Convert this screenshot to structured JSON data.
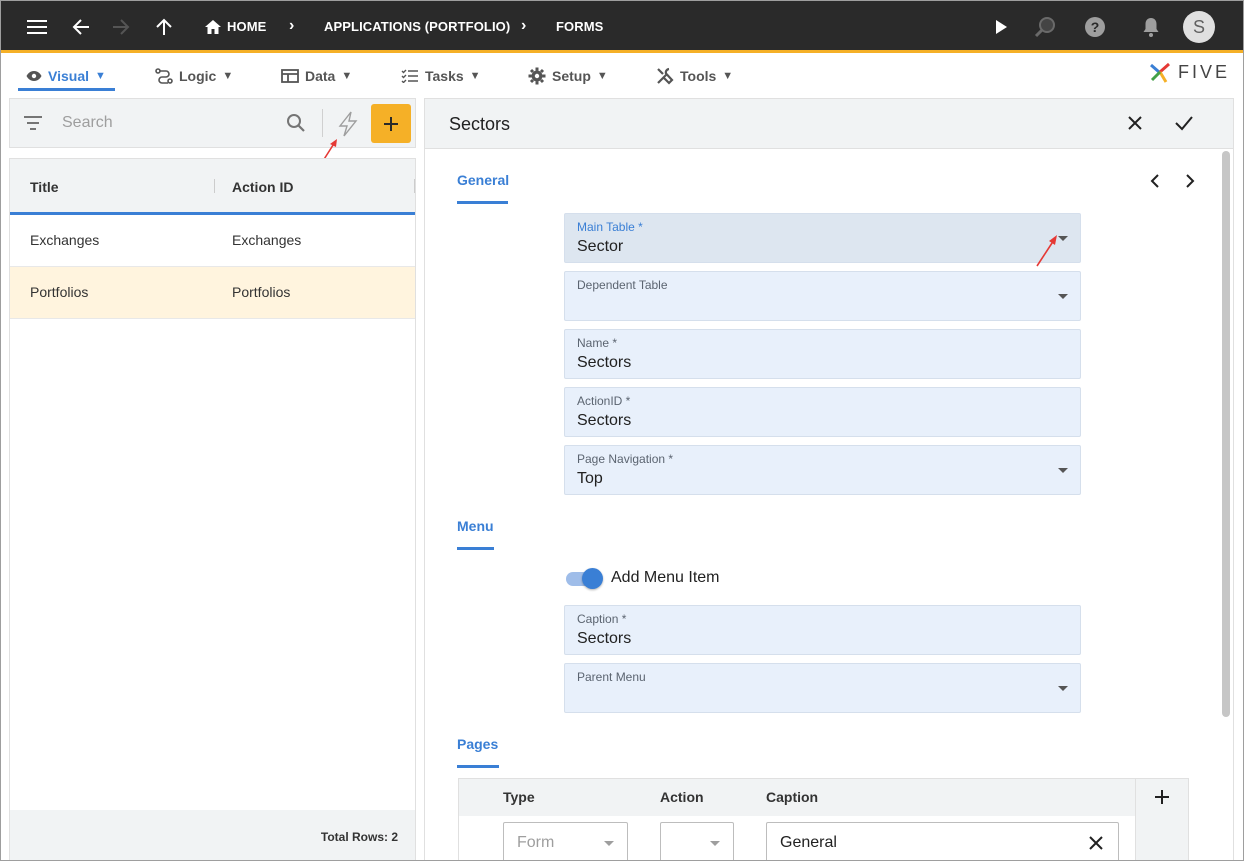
{
  "appbar": {
    "breadcrumbs": [
      "HOME",
      "APPLICATIONS (PORTFOLIO)",
      "FORMS"
    ],
    "avatar_initial": "S",
    "accent": "#f5b027"
  },
  "menubar": {
    "items": [
      {
        "label": "Visual",
        "icon": "eye-icon",
        "active": true
      },
      {
        "label": "Logic",
        "icon": "flow-icon"
      },
      {
        "label": "Data",
        "icon": "table-icon"
      },
      {
        "label": "Tasks",
        "icon": "checklist-icon"
      },
      {
        "label": "Setup",
        "icon": "gear-icon"
      },
      {
        "label": "Tools",
        "icon": "tools-icon"
      }
    ],
    "caret": "▼",
    "logo_text": "FIVE"
  },
  "list": {
    "search_placeholder": "Search",
    "columns": [
      "Title",
      "Action ID"
    ],
    "rows": [
      {
        "title": "Exchanges",
        "action_id": "Exchanges",
        "selected": false
      },
      {
        "title": "Portfolios",
        "action_id": "Portfolios",
        "selected": true
      }
    ],
    "total_rows": "Total Rows: 2"
  },
  "form": {
    "title": "Sectors",
    "sections": {
      "general": "General",
      "menu": "Menu",
      "pages": "Pages"
    },
    "fields": {
      "main_table": {
        "label": "Main Table *",
        "value": "Sector"
      },
      "dependent_table": {
        "label": "Dependent Table",
        "value": ""
      },
      "name": {
        "label": "Name *",
        "value": "Sectors"
      },
      "action_id": {
        "label": "ActionID *",
        "value": "Sectors"
      },
      "page_navigation": {
        "label": "Page Navigation *",
        "value": "Top"
      },
      "add_menu_item": {
        "label": "Add Menu Item",
        "on": true
      },
      "caption": {
        "label": "Caption *",
        "value": "Sectors"
      },
      "parent_menu": {
        "label": "Parent Menu",
        "value": ""
      }
    },
    "pages_grid": {
      "columns": [
        "Type",
        "Action",
        "Caption"
      ],
      "row": {
        "type_placeholder": "Form",
        "action": "",
        "caption": "General"
      }
    }
  }
}
